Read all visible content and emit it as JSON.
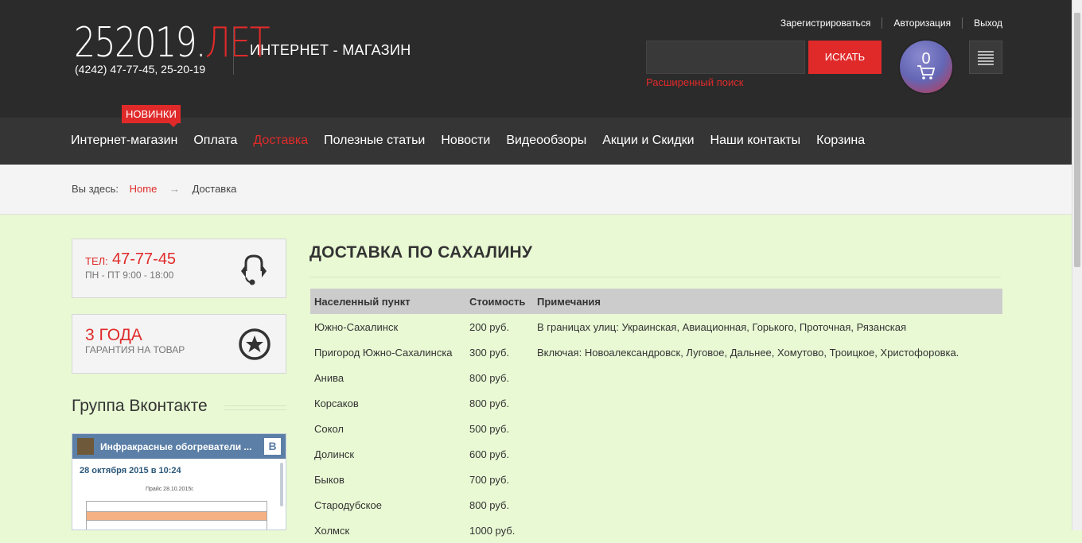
{
  "header": {
    "logo_main": "252019.",
    "logo_accent": "ЛЕТ",
    "phone": "(4242) 47-77-45, 25-20-19",
    "shop_name": "ИНТЕРНЕТ - МАГАЗИН",
    "user_links": [
      "Зарегистрироваться",
      "Авторизация",
      "Выход"
    ],
    "search_value": "",
    "search_button": "ИСКАТЬ",
    "advanced_search": "Расширенный поиск",
    "cart_count": "0",
    "colors": {
      "accent": "#e02a2a",
      "header_bg": "#2b2b2b",
      "nav_bg": "#353535",
      "page_bg": "#e9f9d4"
    }
  },
  "nav": {
    "badge": "НОВИНКИ",
    "items": [
      {
        "label": "Интернет-магазин",
        "active": false
      },
      {
        "label": "Оплата",
        "active": false
      },
      {
        "label": "Доставка",
        "active": true
      },
      {
        "label": "Полезные статьи",
        "active": false
      },
      {
        "label": "Новости",
        "active": false
      },
      {
        "label": "Видеообзоры",
        "active": false
      },
      {
        "label": "Акции и Скидки",
        "active": false
      },
      {
        "label": "Наши контакты",
        "active": false
      },
      {
        "label": "Корзина",
        "active": false
      }
    ]
  },
  "breadcrumb": {
    "prefix": "Вы здесь:",
    "home": "Home",
    "arrow": "→",
    "current": "Доставка"
  },
  "sidebar": {
    "tel_label": "ТЕЛ:",
    "tel_number": "47-77-45",
    "hours": "ПН - ПТ 9:00 - 18:00",
    "guarantee_title": "3 ГОДА",
    "guarantee_sub": "ГАРАНТИЯ НА ТОВАР",
    "vk_heading": "Группа Вконтакте",
    "vk_group_name": "Инфракрасные обогреватели ...",
    "vk_logo": "B",
    "vk_date": "28 октября 2015 в 10:24",
    "vk_price_caption": "Прайс 28.10.2015г."
  },
  "main": {
    "title": "ДОСТАВКА ПО САХАЛИНУ",
    "columns": [
      "Населенный пункт",
      "Стоимость",
      "Примечания"
    ],
    "rows": [
      [
        "Южно-Сахалинск",
        "200 руб.",
        "В границах улиц: Украинская, Авиационная, Горького, Проточная, Рязанская"
      ],
      [
        "Пригород Южно-Сахалинска",
        "300 руб.",
        "Включая: Новоалександровск, Луговое, Дальнее, Хомутово, Троицкое, Христофоровка."
      ],
      [
        "Анива",
        "800 руб.",
        ""
      ],
      [
        "Корсаков",
        "800 руб.",
        ""
      ],
      [
        "Сокол",
        "500 руб.",
        ""
      ],
      [
        "Долинск",
        "600 руб.",
        ""
      ],
      [
        "Быков",
        "700 руб.",
        ""
      ],
      [
        "Стародубское",
        "800 руб.",
        ""
      ],
      [
        "Холмск",
        "1000 руб.",
        ""
      ]
    ]
  }
}
